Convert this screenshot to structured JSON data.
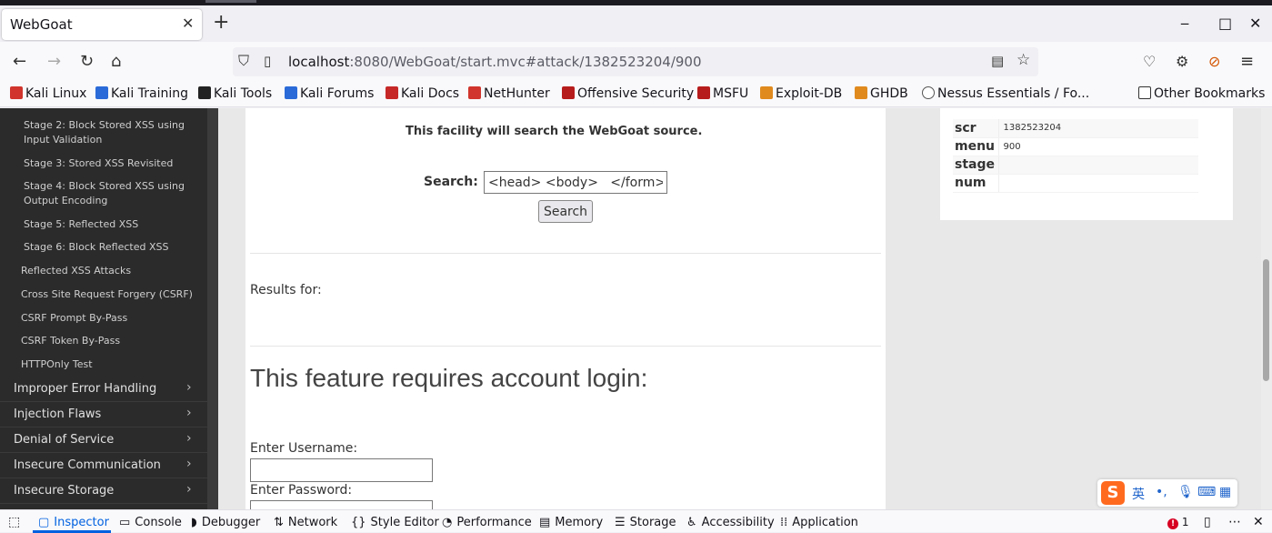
{
  "browser": {
    "tab_title": "WebGoat",
    "tab_close": "✕",
    "new_tab": "+",
    "window_controls": [
      "‒",
      "□",
      "✕"
    ],
    "url_host": "localhost",
    "url_path": ":8080/WebGoat/start.mvc#attack/1382523204/900"
  },
  "bookmarks": [
    {
      "label": "Kali Linux",
      "color": "#d0342c"
    },
    {
      "label": "Kali Training",
      "color": "#2a6ad8"
    },
    {
      "label": "Kali Tools",
      "color": "#222222"
    },
    {
      "label": "Kali Forums",
      "color": "#2a6ad8"
    },
    {
      "label": "Kali Docs",
      "color": "#c62828"
    },
    {
      "label": "NetHunter",
      "color": "#d0342c"
    },
    {
      "label": "Offensive Security",
      "color": "#b71c1c"
    },
    {
      "label": "MSFU",
      "color": "#b71c1c"
    },
    {
      "label": "Exploit-DB",
      "color": "#e08a1e"
    },
    {
      "label": "GHDB",
      "color": "#e08a1e"
    },
    {
      "label": "Nessus Essentials / Fo...",
      "color": "#555555"
    }
  ],
  "other_bookmarks": "Other Bookmarks",
  "sidebar": {
    "sub_items": [
      "Stage 2: Block Stored XSS using Input Validation",
      "Stage 3: Stored XSS Revisited",
      "Stage 4: Block Stored XSS using Output Encoding",
      "Stage 5: Reflected XSS",
      "Stage 6: Block Reflected XSS",
      "Reflected XSS Attacks",
      "Cross Site Request Forgery (CSRF)",
      "CSRF Prompt By-Pass",
      "CSRF Token By-Pass",
      "HTTPOnly Test"
    ],
    "categories": [
      "Improper Error Handling",
      "Injection Flaws",
      "Denial of Service",
      "Insecure Communication",
      "Insecure Storage"
    ],
    "chevron": "›"
  },
  "main": {
    "facility_text": "This facility will search the WebGoat source.",
    "search_label": "Search:",
    "search_value": "<head> <body>   </form>",
    "search_button": "Search",
    "results_for": "Results for:",
    "feature_heading": "This feature requires account login:",
    "username_label": "Enter Username:",
    "password_label": "Enter Password:"
  },
  "params": [
    {
      "key": "scr",
      "value": "1382523204"
    },
    {
      "key": "menu",
      "value": "900"
    },
    {
      "key": "stage",
      "value": ""
    },
    {
      "key": "num",
      "value": ""
    }
  ],
  "ime": {
    "logo": "S",
    "lang": "英",
    "punct": "•,"
  },
  "devtools": {
    "tabs": [
      {
        "label": "Inspector",
        "icon": "▢"
      },
      {
        "label": "Console",
        "icon": "▭"
      },
      {
        "label": "Debugger",
        "icon": "◗"
      },
      {
        "label": "Network",
        "icon": "⇅"
      },
      {
        "label": "Style Editor",
        "icon": "{}"
      },
      {
        "label": "Performance",
        "icon": "◔"
      },
      {
        "label": "Memory",
        "icon": "▤"
      },
      {
        "label": "Storage",
        "icon": "☰"
      },
      {
        "label": "Accessibility",
        "icon": "♿"
      },
      {
        "label": "Application",
        "icon": "⁞⁞"
      }
    ],
    "error_count": "1"
  },
  "colors": {
    "accent": "#0061e0",
    "sidebar_bg": "#2b2b2b"
  }
}
